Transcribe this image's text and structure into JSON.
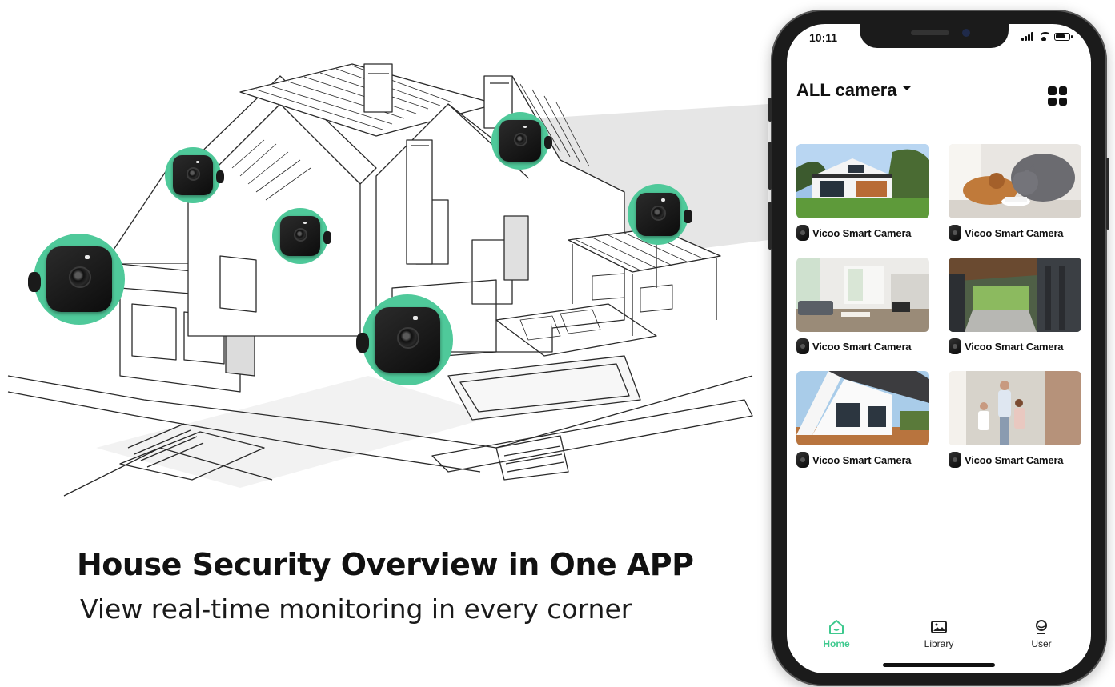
{
  "marketing": {
    "headline": "House Security Overview in One APP",
    "subline": "View real-time monitoring in every corner"
  },
  "phone": {
    "status_time": "10:11",
    "header": {
      "title": "ALL camera",
      "dropdown_icon": "caret-down-icon",
      "layout_icon": "grid-view-icon"
    },
    "cameras": [
      {
        "name": "Vicoo Smart Camera",
        "scene": "modern-house-exterior"
      },
      {
        "name": "Vicoo Smart Camera",
        "scene": "pets-eating"
      },
      {
        "name": "Vicoo Smart Camera",
        "scene": "living-room"
      },
      {
        "name": "Vicoo Smart Camera",
        "scene": "patio-corridor"
      },
      {
        "name": "Vicoo Smart Camera",
        "scene": "a-frame-house"
      },
      {
        "name": "Vicoo Smart Camera",
        "scene": "family-doorway"
      }
    ],
    "tabs": [
      {
        "label": "Home",
        "icon": "home-icon",
        "active": true
      },
      {
        "label": "Library",
        "icon": "image-icon",
        "active": false
      },
      {
        "label": "User",
        "icon": "user-icon",
        "active": false
      }
    ]
  },
  "colors": {
    "accent_green": "#3ec98e",
    "badge_green": "#4fc99a"
  }
}
